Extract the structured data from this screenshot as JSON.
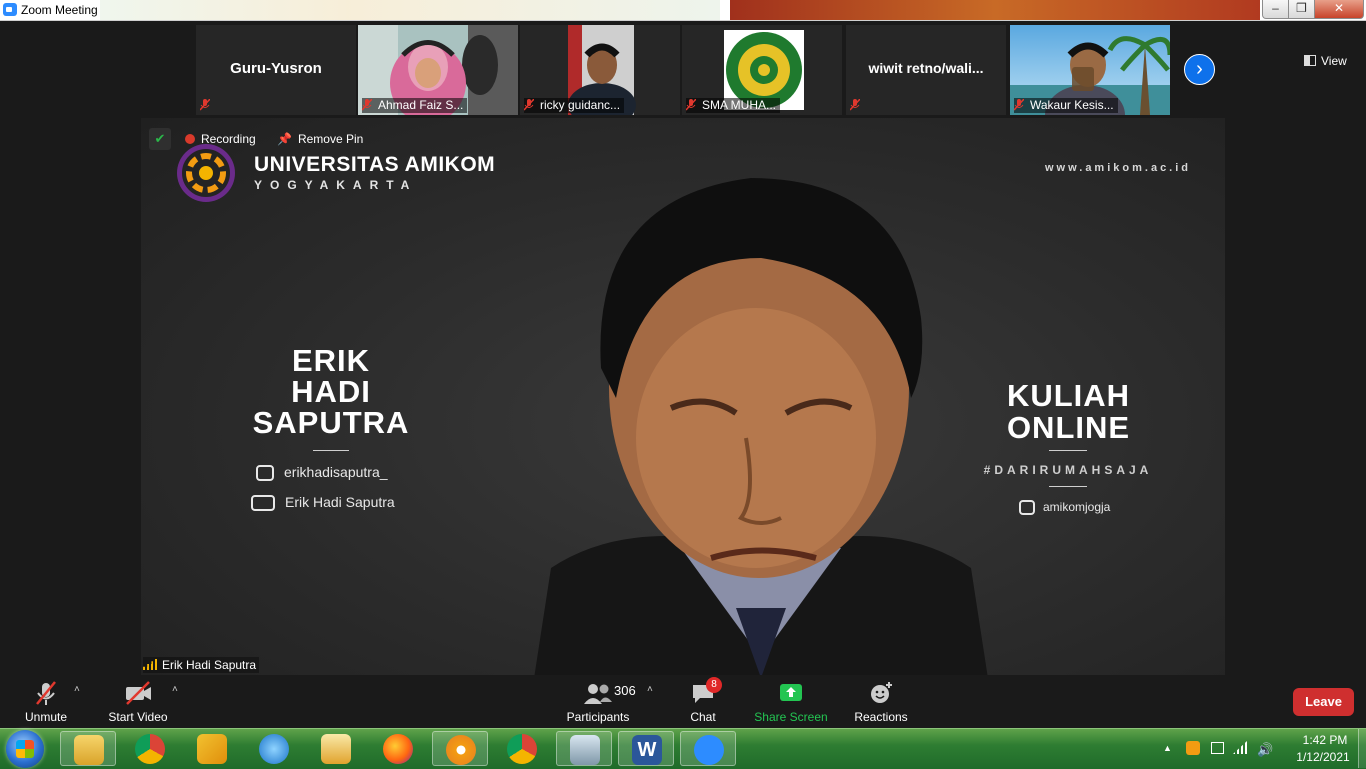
{
  "window": {
    "title": "Zoom Meeting",
    "minimize": "–",
    "maximize": "❒",
    "close": "✕"
  },
  "strip": {
    "view_label": "View",
    "next_glyph": "›",
    "participants": [
      {
        "name": "Guru-Yusron",
        "label": ""
      },
      {
        "name": "",
        "label": "Ahmad Faiz S..."
      },
      {
        "name": "",
        "label": "ricky guidanc..."
      },
      {
        "name": "",
        "label": "SMA MUHA..."
      },
      {
        "name": "wiwit  retno/wali...",
        "label": ""
      },
      {
        "name": "",
        "label": "Wakaur Kesis..."
      }
    ]
  },
  "main": {
    "recording_label": "Recording",
    "remove_pin_label": "Remove Pin",
    "shield_glyph": "✔",
    "speaker_name": "Erik Hadi Saputra",
    "slide": {
      "brand_name": "UNIVERSITAS AMIKOM",
      "brand_sub": "YOGYAKARTA",
      "url": "www.amikom.ac.id",
      "name_line1": "ERIK",
      "name_line2": "HADI",
      "name_line3": "SAPUTRA",
      "instagram": "erikhadisaputra_",
      "youtube": "Erik Hadi Saputra",
      "kuliah1": "KULIAH",
      "kuliah2": "ONLINE",
      "hashtag": "#DARIRUMAHSAJA",
      "instagram2": "amikomjogja"
    }
  },
  "toolbar": {
    "unmute": "Unmute",
    "start_video": "Start Video",
    "participants_label": "Participants",
    "participants_count": "306",
    "chat": "Chat",
    "chat_badge": "8",
    "share_screen": "Share Screen",
    "reactions": "Reactions",
    "leave": "Leave",
    "caret": "˄"
  },
  "taskbar": {
    "time": "1:42 PM",
    "date": "1/12/2021",
    "tray_up": "▲"
  },
  "colors": {
    "accent": "#0e71eb",
    "leave": "#cf2f2f",
    "share": "#23c552",
    "muted": "#e0382e"
  }
}
